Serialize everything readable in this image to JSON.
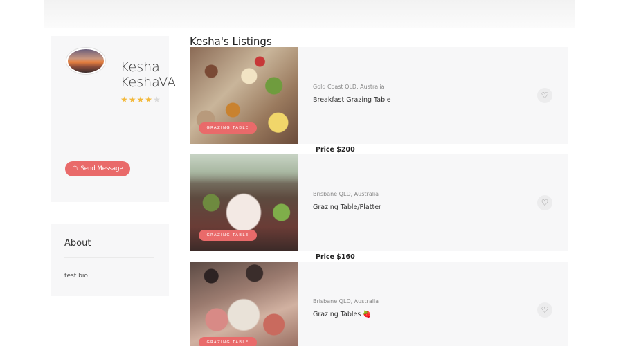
{
  "profile": {
    "name": "Kesha KeshaVA",
    "rating": 4,
    "rating_max": 5,
    "star_glyph": "★",
    "send_message_label": "Send Message"
  },
  "about": {
    "title": "About",
    "bio": "test bio"
  },
  "listings_heading": "Kesha's Listings",
  "listings": [
    {
      "location": "Gold Coast QLD, Australia",
      "title": "Breakfast Grazing Table",
      "tag": "GRAZING TABLE",
      "price": "Price $200"
    },
    {
      "location": "Brisbane QLD, Australia",
      "title": "Grazing Table/Platter",
      "tag": "GRAZING TABLE",
      "price": "Price $160"
    },
    {
      "location": "Brisbane QLD, Australia",
      "title": "Grazing Tables 🍓",
      "tag": "GRAZING TABLE",
      "price": ""
    }
  ],
  "icons": {
    "heart": "♡",
    "message": "☖"
  },
  "colors": {
    "accent": "#e96a6a",
    "star": "#f3b93b",
    "card_bg": "#f7f7f8"
  }
}
